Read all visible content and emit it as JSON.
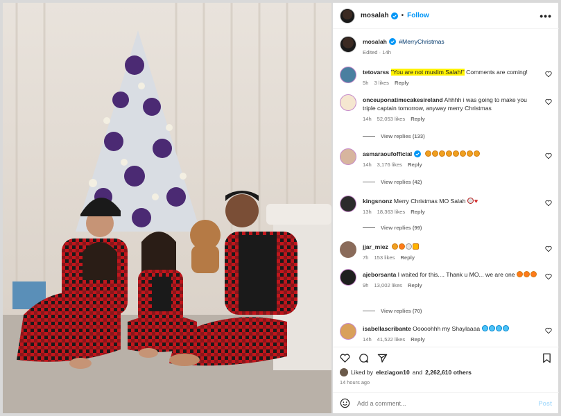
{
  "header": {
    "username": "mosalah",
    "separator": "•",
    "follow_label": "Follow",
    "more_label": "•••"
  },
  "caption": {
    "username": "mosalah",
    "text": "#MerryChristmas",
    "edited": "Edited · 14h"
  },
  "comments": [
    {
      "username": "tetovarss",
      "text_highlight": "\"You are not muslim Salah!\"",
      "text": " Comments are coming!",
      "time": "5h",
      "likes": "3 likes",
      "reply": "Reply"
    },
    {
      "username": "onceuponatimecakesireland",
      "text": "Ahhhh i was going to make you triple captain tomorrow, anyway merry Christmas",
      "time": "14h",
      "likes": "52,053 likes",
      "reply": "Reply",
      "view_replies": "View replies (133)"
    },
    {
      "username": "asmaraoufofficial",
      "text": "",
      "time": "14h",
      "likes": "3,176 likes",
      "reply": "Reply",
      "view_replies": "View replies (42)"
    },
    {
      "username": "kingsnonz",
      "text": "Merry Christmas MO Salah",
      "time": "13h",
      "likes": "18,363 likes",
      "reply": "Reply",
      "view_replies": "View replies (99)"
    },
    {
      "username": "jjar_miez",
      "text": "",
      "time": "7h",
      "likes": "153 likes",
      "reply": "Reply"
    },
    {
      "username": "ajeborsanta",
      "text": "I waited for this.... Thank u MO... we are one",
      "time": "9h",
      "likes": "13,002 likes",
      "reply": "Reply",
      "view_replies": "View replies (70)"
    },
    {
      "username": "isabellascribante",
      "text": "Ooooohhh my Shaylaaaa",
      "time": "14h",
      "likes": "41,522 likes",
      "reply": "Reply"
    }
  ],
  "footer": {
    "liked_prefix": "Liked by",
    "liked_user": "eleziagon10",
    "liked_and": "and",
    "liked_others": "2,262,610 others",
    "time_ago": "14 hours ago",
    "add_comment_placeholder": "Add a comment...",
    "post_label": "Post"
  },
  "colors": {
    "accent": "#0095f6",
    "highlight": "#fff200",
    "verified": "#0095f6"
  },
  "icons": [
    "verified-badge-icon",
    "heart-icon",
    "comment-icon",
    "share-icon",
    "bookmark-icon",
    "emoji-icon"
  ]
}
